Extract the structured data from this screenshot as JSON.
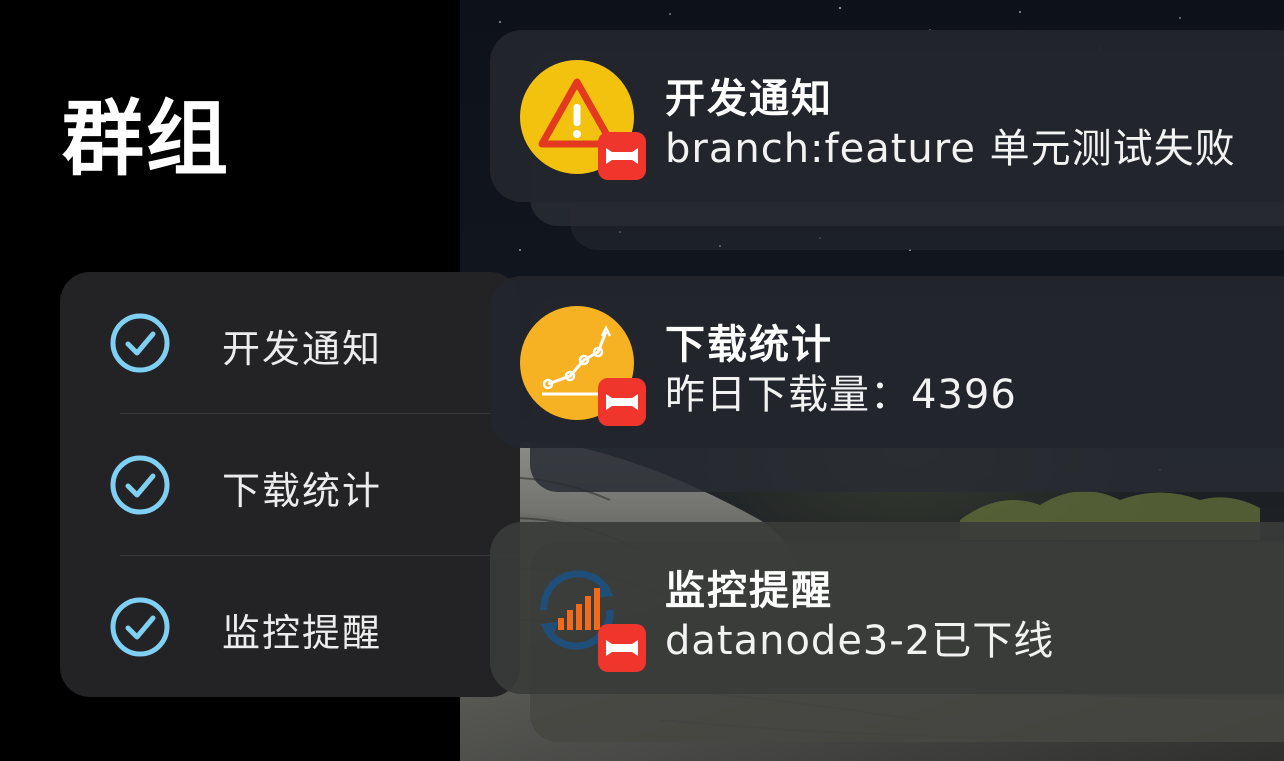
{
  "left_panel": {
    "title": "群组",
    "groups": [
      {
        "label": "开发通知",
        "checked": true
      },
      {
        "label": "下载统计",
        "checked": true
      },
      {
        "label": "监控提醒",
        "checked": true
      }
    ]
  },
  "notifications": [
    {
      "title": "开发通知",
      "body": "branch:feature 单元测试失败",
      "icon": "warning-icon"
    },
    {
      "title": "下载统计",
      "body": "昨日下载量：4396",
      "icon": "growth-chart-icon"
    },
    {
      "title": "监控提醒",
      "body": "datanode3-2已下线",
      "icon": "sync-bar-chart-icon"
    }
  ],
  "colors": {
    "check": "#7fd0f3",
    "badge": "#f0362c",
    "warning_circle": "#f2c20f",
    "chart_circle": "#f6b222",
    "sync_arrow": "#1f4e79",
    "bars": "#f26b1d"
  }
}
